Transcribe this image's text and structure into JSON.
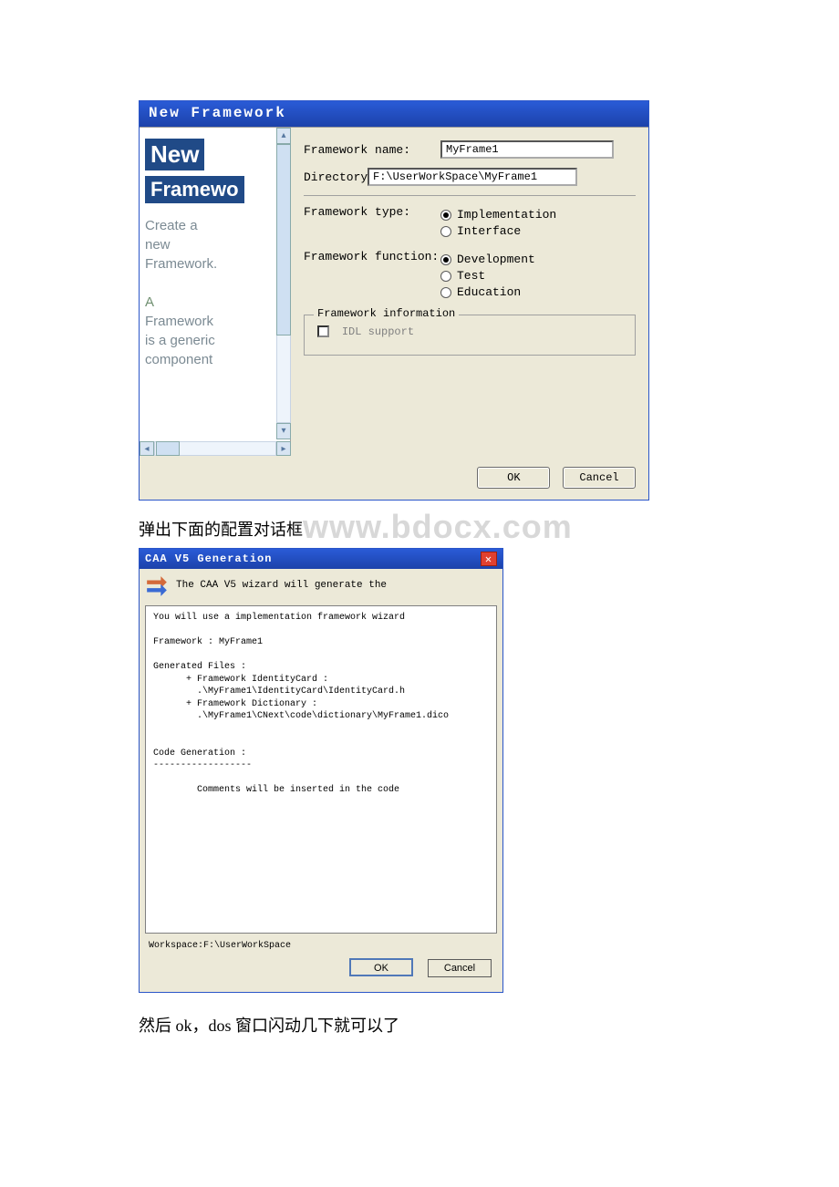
{
  "dialog1": {
    "title": "New Framework",
    "left": {
      "big1": "New",
      "big2": "Framewo",
      "desc1": "Create a",
      "desc2": "new",
      "desc3": "Framework.",
      "desc4": "A",
      "desc5": "Framework",
      "desc6": "is a generic",
      "desc7": "component"
    },
    "right": {
      "name_label": "Framework name:",
      "name_value": "MyFrame1",
      "dir_label": "Directory:",
      "dir_value": "F:\\UserWorkSpace\\MyFrame1",
      "type_label": "Framework type:",
      "type_options": {
        "implementation": "Implementation",
        "interface": "Interface"
      },
      "func_label": "Framework function:",
      "func_options": {
        "development": "Development",
        "test": "Test",
        "education": "Education"
      },
      "group_legend": "Framework information",
      "idl_label": "IDL support"
    },
    "buttons": {
      "ok": "OK",
      "cancel": "Cancel"
    }
  },
  "caption_cn": "弹出下面的配置对话框",
  "watermark": "www.bdocx.com",
  "dialog2": {
    "title": "CAA V5 Generation",
    "head": "The CAA V5 wizard will generate the",
    "body": "You will use a implementation framework wizard\n\nFramework : MyFrame1\n\nGenerated Files :\n      + Framework IdentityCard :\n        .\\MyFrame1\\IdentityCard\\IdentityCard.h\n      + Framework Dictionary :\n        .\\MyFrame1\\CNext\\code\\dictionary\\MyFrame1.dico\n\n\nCode Generation :\n------------------\n\n        Comments will be inserted in the code",
    "workspace_label": "Workspace:F:\\UserWorkSpace",
    "buttons": {
      "ok": "OK",
      "cancel": "Cancel"
    }
  },
  "footer_cn": "然后 ok，dos 窗口闪动几下就可以了"
}
